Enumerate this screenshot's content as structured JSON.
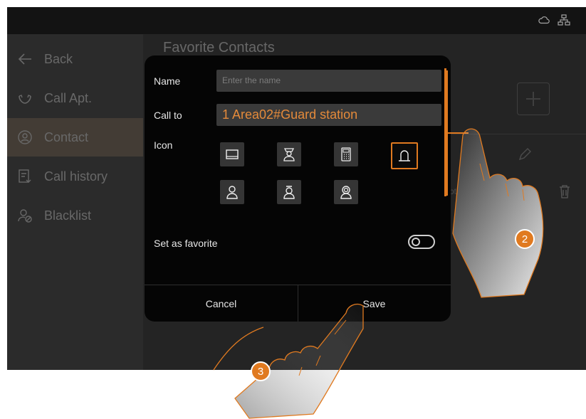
{
  "sidebar": {
    "items": [
      {
        "label": "Back",
        "icon": "arrow-left-icon"
      },
      {
        "label": "Call Apt.",
        "icon": "phone-handset-icon"
      },
      {
        "label": "Contact",
        "icon": "contact-icon",
        "active": true
      },
      {
        "label": "Call history",
        "icon": "call-history-icon"
      },
      {
        "label": "Blacklist",
        "icon": "blacklist-icon"
      }
    ]
  },
  "main": {
    "title": "Favorite Contacts",
    "bg_partial_text": "pt"
  },
  "dialog": {
    "name_label": "Name",
    "name_placeholder": "Enter the name",
    "callto_label": "Call to",
    "callto_value": "1 Area02#Guard station",
    "icon_label": "Icon",
    "favorite_label": "Set as favorite",
    "favorite_on": false,
    "cancel_label": "Cancel",
    "save_label": "Save"
  },
  "callouts": {
    "step2": "2",
    "step3": "3"
  },
  "colors": {
    "accent": "#e07a20",
    "dialog_bg": "#050505",
    "field_bg": "#3a3a3a"
  }
}
